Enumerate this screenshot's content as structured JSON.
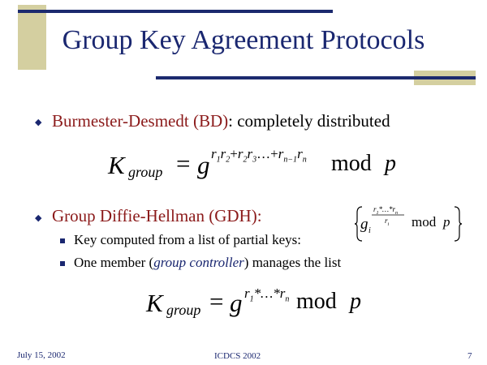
{
  "title": "Group Key Agreement Protocols",
  "bullets": {
    "bd": {
      "name": "Burmester-Desmedt (BD)",
      "rest": ": completely distributed"
    },
    "gdh": {
      "name": "Group Diffie-Hellman (GDH):",
      "subitems": [
        {
          "text": "Key computed from a list of partial keys:"
        },
        {
          "before": "One member (",
          "emph": "group controller",
          "after": ") manages the list"
        }
      ]
    }
  },
  "formulas": {
    "bd_formula": {
      "K": "K",
      "group": "group",
      "equals": "=",
      "g": "g",
      "exp": {
        "r1": "r",
        "s1": "1",
        "r2": "r",
        "s2": "2",
        "plus1": "+",
        "r3": "r",
        "s3": "2",
        "r4": "r",
        "s4": "3",
        "dots": "…+",
        "r5": "r",
        "s5": "n−1",
        "r6": "r",
        "s6": "n"
      },
      "mod": "mod",
      "p": "p"
    },
    "partial_key": {
      "g": "g",
      "i": "i",
      "num": "r",
      "num_sub1": "1",
      "num_mid": "*…*r",
      "num_sub2": "n",
      "den": "r",
      "den_sub": "i",
      "mod": "mod",
      "p": "p"
    },
    "gdh_formula": {
      "K": "K",
      "group": "group",
      "equals": "=",
      "g": "g",
      "exp_r1": "r",
      "exp_s1": "1",
      "exp_mid": "*…*",
      "exp_rn": "r",
      "exp_sn": "n",
      "mod": "mod",
      "p": "p"
    }
  },
  "footer": {
    "date": "July 15, 2002",
    "conference": "ICDCS 2002",
    "page": "7"
  },
  "colors": {
    "navy": "#1a2770",
    "line": "#1c2a6e",
    "accent_square": "#d4cfa0",
    "dark_red": "#8b1a1a"
  }
}
